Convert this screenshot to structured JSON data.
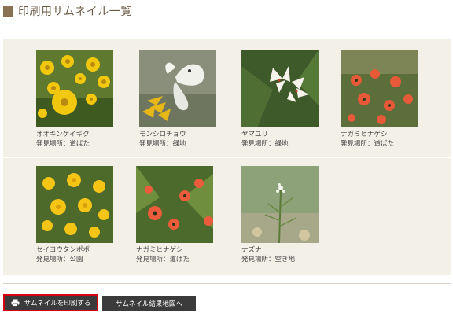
{
  "page": {
    "title": "印刷用サムネイル一覧"
  },
  "cards": [
    {
      "name": "オオキンケイギク",
      "place": "発見場所：道ばた",
      "image": "yellow-coreopsis-flowers"
    },
    {
      "name": "モンシロチョウ",
      "place": "発見場所：緑地",
      "image": "white-cabbage-butterfly"
    },
    {
      "name": "ヤマユリ",
      "place": "発見場所：緑地",
      "image": "white-mountain-lily"
    },
    {
      "name": "ナガミヒナゲシ",
      "place": "発見場所：道ばた",
      "image": "orange-poppies"
    },
    {
      "name": "セイヨウタンポポ",
      "place": "発見場所：公園",
      "image": "yellow-dandelions"
    },
    {
      "name": "ナガミヒナゲシ",
      "place": "発見場所：道ばた",
      "image": "orange-poppies"
    },
    {
      "name": "ナズナ",
      "place": "発見場所：空き地",
      "image": "shepherds-purse-plant"
    }
  ],
  "buttons": {
    "print_label": "サムネイルを印刷する",
    "map_label": "サムネイル結果地図へ"
  },
  "colors": {
    "title_square": "#8a7355",
    "panel_background": "#f3f0e8",
    "button_background": "#3b3b3b",
    "print_highlight": "#d6000f"
  },
  "icons": {
    "print_button": "printer-icon"
  }
}
